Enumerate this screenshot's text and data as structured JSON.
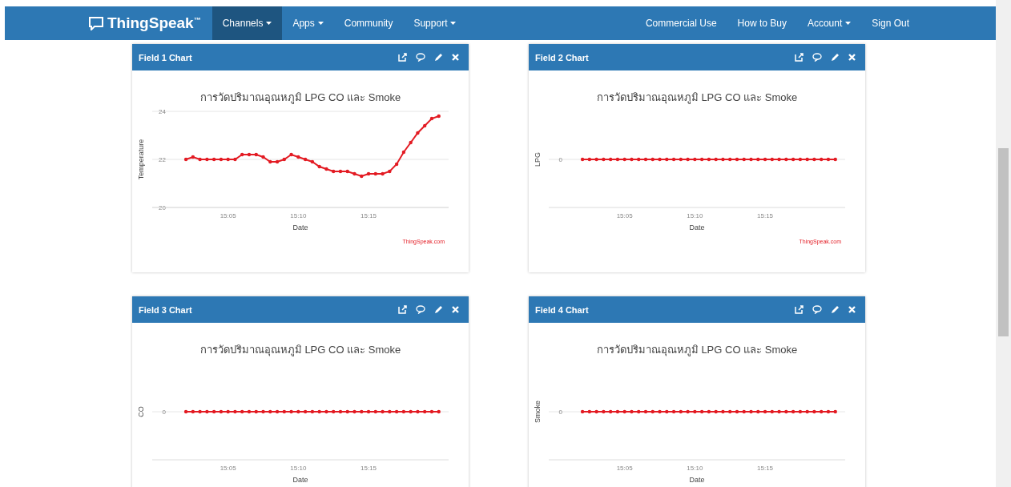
{
  "navbar": {
    "logo": "ThingSpeak$^{™}$",
    "left_items": [
      {
        "label": "Channels",
        "dropdown": true,
        "selected": true
      },
      {
        "label": "Apps",
        "dropdown": true,
        "selected": false
      },
      {
        "label": "Community",
        "dropdown": false,
        "selected": false
      },
      {
        "label": "Support",
        "dropdown": true,
        "selected": false
      }
    ],
    "right_items": [
      {
        "label": "Commercial Use",
        "dropdown": false,
        "selected": false
      },
      {
        "label": "How to Buy",
        "dropdown": false,
        "selected": false
      },
      {
        "label": "Account",
        "dropdown": true,
        "selected": false
      },
      {
        "label": "Sign Out",
        "dropdown": false,
        "selected": false
      }
    ]
  },
  "cards": [
    {
      "title": "Field 1 Chart",
      "credit": "ThingSpeak.com",
      "chart_data": {
        "type": "line",
        "title": "การวัดปริมาณอุณหภูมิ LPG CO และ Smoke",
        "xlabel": "Date",
        "ylabel": "Temperature",
        "categories": [
          null,
          null,
          null,
          null,
          null,
          null,
          "15:05",
          null,
          null,
          null,
          null,
          null,
          null,
          null,
          null,
          null,
          "15:10",
          null,
          null,
          null,
          null,
          null,
          null,
          null,
          null,
          null,
          "15:15",
          null,
          null,
          null,
          null,
          null,
          null,
          null,
          null,
          null,
          null
        ],
        "series": [
          {
            "color": "#e31b23",
            "values": [
              22.0,
              22.1,
              22.0,
              22.0,
              22.0,
              22.0,
              22.0,
              22.0,
              22.2,
              22.2,
              22.2,
              22.1,
              21.9,
              21.9,
              22.0,
              22.2,
              22.1,
              22.0,
              21.9,
              21.7,
              21.6,
              21.5,
              21.5,
              21.5,
              21.4,
              21.3,
              21.4,
              21.4,
              21.4,
              21.5,
              21.8,
              22.3,
              22.7,
              23.1,
              23.4,
              23.7,
              23.8
            ]
          }
        ],
        "ylim": [
          20,
          24
        ],
        "yticks": [
          20,
          22,
          24
        ]
      }
    },
    {
      "title": "Field 2 Chart",
      "credit": "ThingSpeak.com",
      "plot": {
        "title": "การวัดปริมาณอุณหภูมิ LPG CO และ Smoke",
        "xlabel": "Date",
        "ylabel": "LPG",
        "x_tick_labels": [
          "15:05",
          "15:10",
          "15:15"
        ],
        "y_tick_label": "0"
      }
    },
    {
      "title": "Field 3 Chart",
      "plot": {
        "title": "การวัดปริมาณอุณหภูมิ LPG CO และ Smoke",
        "xlabel": "Date",
        "ylabel": "CO",
        "x_tick_labels": [
          "15:05",
          "15:10",
          "15:15"
        ],
        "y_tick_label": "0"
      }
    },
    {
      "title": "Field 4 Chart",
      "plot": {
        "title": "การวัดปริมาณอุณหภูมิ LPG CO และ Smoke",
        "xlabel": "Date",
        "ylabel": "Smoke",
        "x_tick_labels": [
          "15:05",
          "15:10",
          "15:15"
        ],
        "y_tick_label": "0"
      }
    }
  ]
}
